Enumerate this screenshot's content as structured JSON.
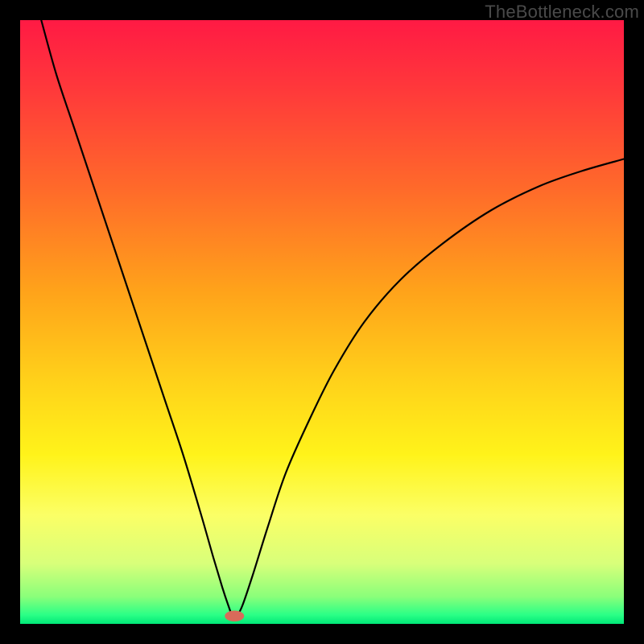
{
  "watermark": "TheBottleneck.com",
  "chart_data": {
    "type": "line",
    "title": "",
    "xlabel": "",
    "ylabel": "",
    "xlim": [
      0,
      100
    ],
    "ylim": [
      0,
      100
    ],
    "grid": false,
    "legend": false,
    "background_gradient": {
      "stops": [
        {
          "offset": 0.0,
          "color": "#ff1a44"
        },
        {
          "offset": 0.12,
          "color": "#ff3a3a"
        },
        {
          "offset": 0.28,
          "color": "#ff6a2a"
        },
        {
          "offset": 0.45,
          "color": "#ffa31a"
        },
        {
          "offset": 0.6,
          "color": "#ffd21a"
        },
        {
          "offset": 0.72,
          "color": "#fff31a"
        },
        {
          "offset": 0.82,
          "color": "#fbff66"
        },
        {
          "offset": 0.9,
          "color": "#d8ff7a"
        },
        {
          "offset": 0.955,
          "color": "#8aff7a"
        },
        {
          "offset": 0.985,
          "color": "#2bff86"
        },
        {
          "offset": 1.0,
          "color": "#00e878"
        }
      ]
    },
    "series": [
      {
        "name": "curve",
        "color": "#000000",
        "width": 2.2,
        "x": [
          3.5,
          6,
          9,
          12,
          15,
          18,
          21,
          24,
          27,
          30,
          32,
          33.5,
          34.5,
          35.2,
          35.8,
          36.8,
          38.5,
          41,
          44,
          48,
          52,
          57,
          63,
          70,
          78,
          86,
          93,
          100
        ],
        "y": [
          100,
          91,
          82,
          73,
          64,
          55,
          46,
          37,
          28,
          18,
          11,
          6,
          3,
          1.2,
          1.2,
          3,
          8,
          16,
          25,
          34,
          42,
          50,
          57,
          63,
          68.5,
          72.5,
          75,
          77
        ]
      }
    ],
    "marker": {
      "name": "min-point",
      "x": 35.5,
      "y": 1.3,
      "rx": 1.6,
      "ry": 0.9,
      "color": "#d96a5a"
    }
  }
}
